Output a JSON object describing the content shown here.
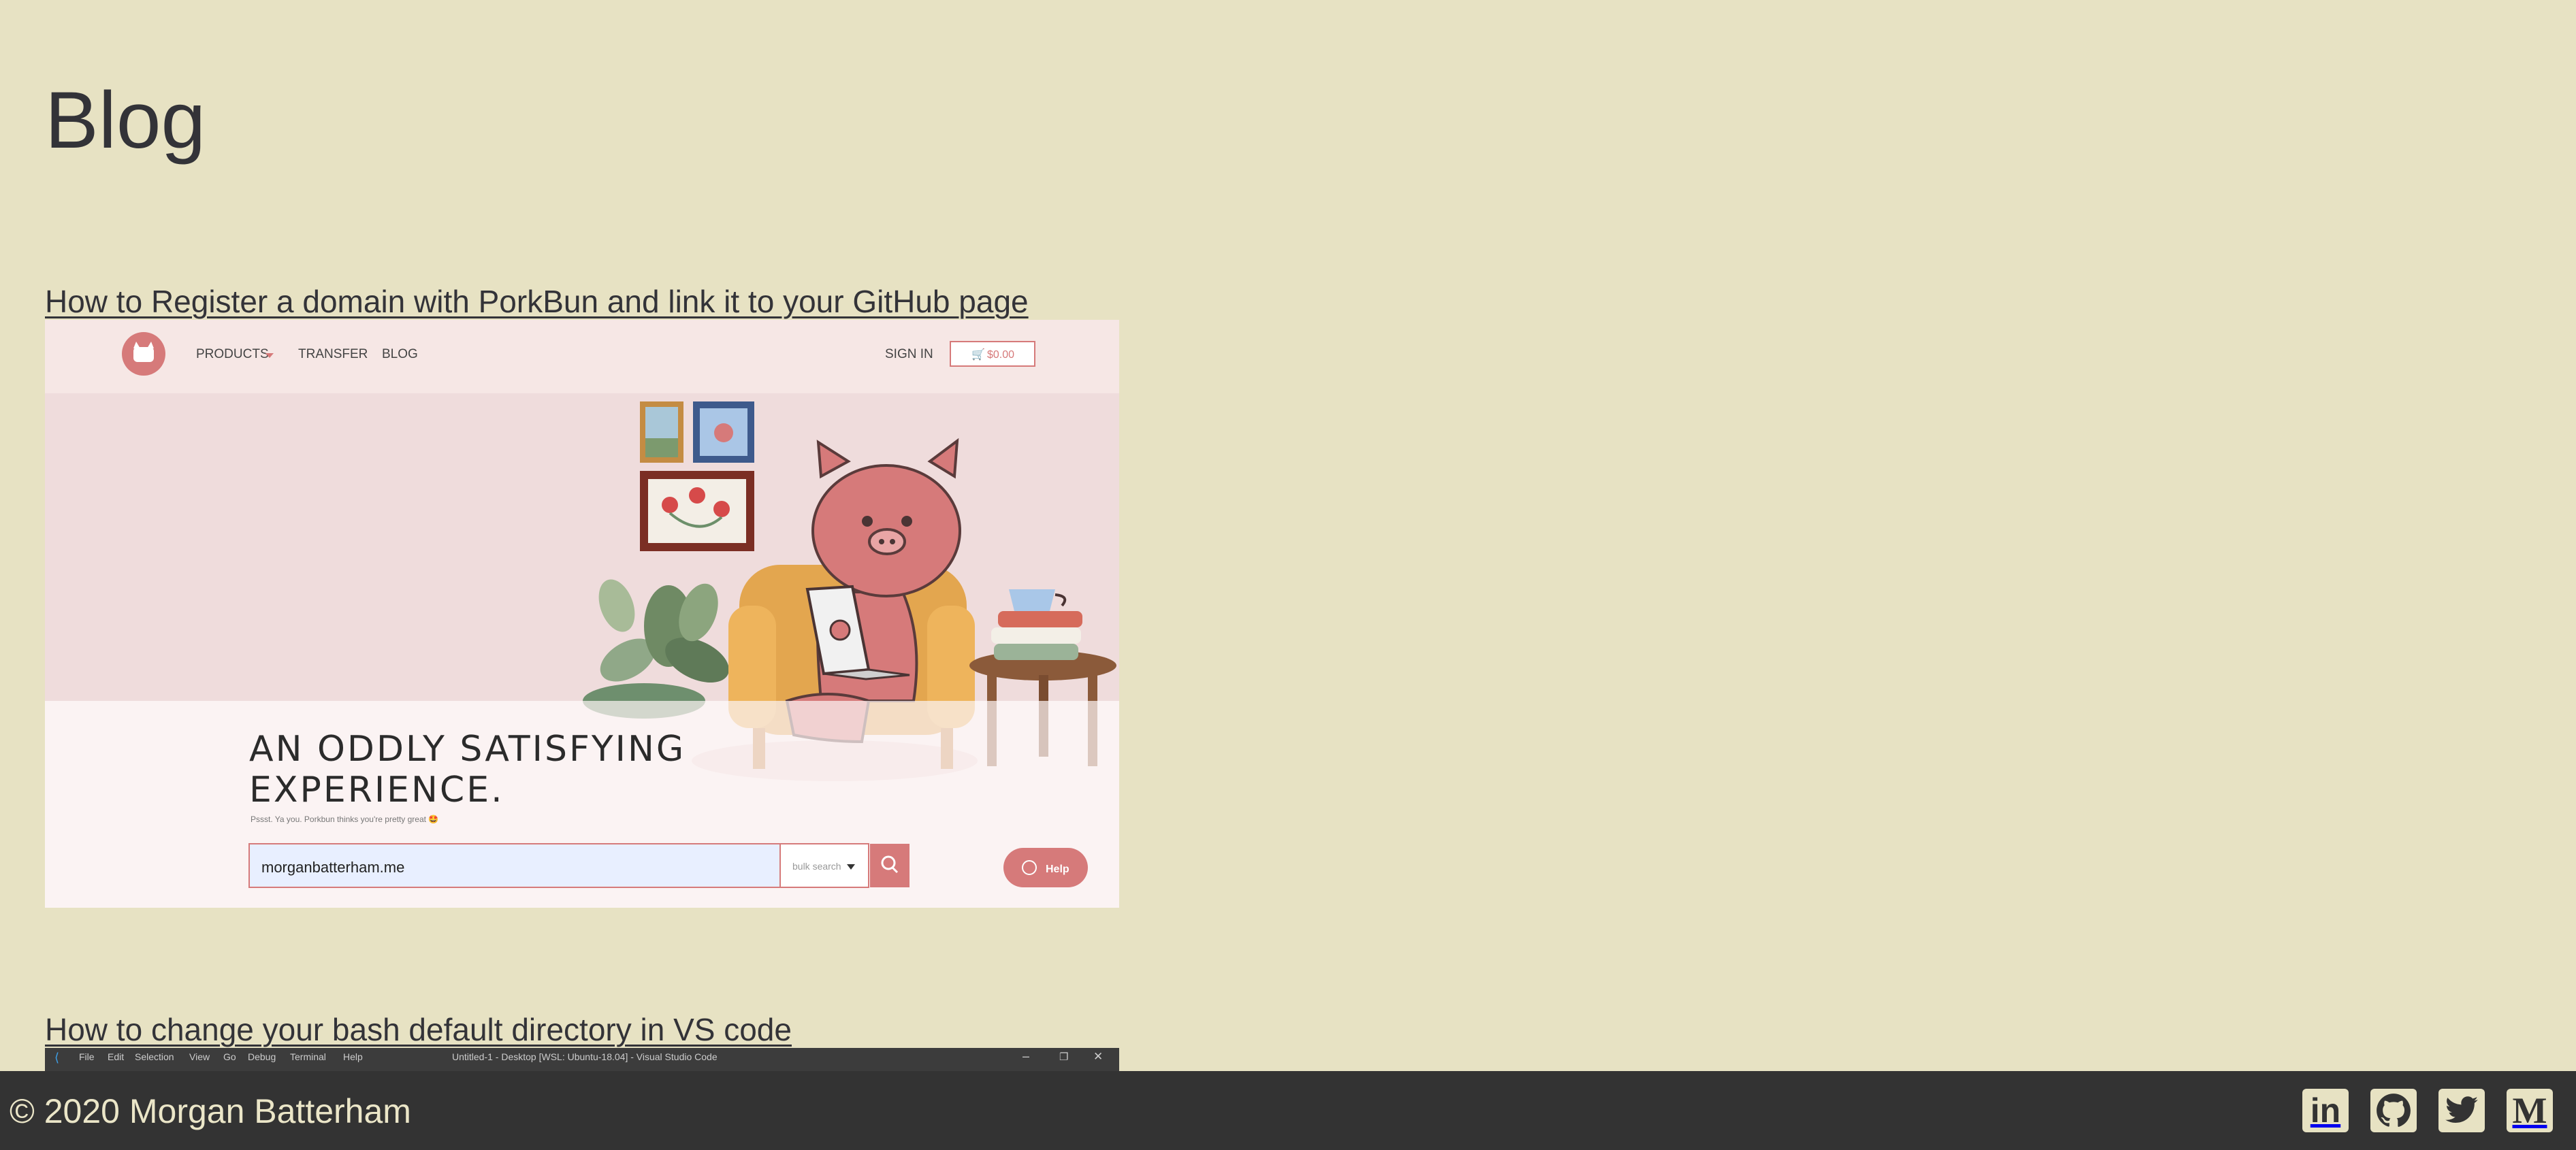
{
  "page": {
    "title": "Blog"
  },
  "posts": [
    {
      "title": "How to Register a domain with PorkBun and link it to your GitHub page",
      "screenshot": {
        "nav": {
          "products": "PRODUCTS",
          "transfer": "TRANSFER",
          "blog": "BLOG",
          "sign_in": "SIGN IN",
          "cart": "$0.00"
        },
        "headline_line1": "AN ODDLY SATISFYING",
        "headline_line2": "EXPERIENCE.",
        "subtext": "Pssst. Ya you. Porkbun thinks you're pretty great 🤩",
        "search_value": "morganbatterham.me",
        "bulk_search": "bulk search",
        "help": "Help"
      }
    },
    {
      "title": "How to change your bash default directory in VS code",
      "screenshot": {
        "menu": [
          "File",
          "Edit",
          "Selection",
          "View",
          "Go",
          "Debug",
          "Terminal",
          "Help"
        ],
        "window_title": "Untitled-1 - Desktop [WSL: Ubuntu-18.04] - Visual Studio Code"
      }
    }
  ],
  "footer": {
    "copyright": "© 2020 Morgan Batterham"
  },
  "social": [
    {
      "name": "linkedin",
      "glyph": "in"
    },
    {
      "name": "github",
      "glyph": ""
    },
    {
      "name": "twitter",
      "glyph": ""
    },
    {
      "name": "medium",
      "glyph": "M"
    }
  ],
  "colors": {
    "background": "#e7e2c3",
    "text": "#333338",
    "footer": "#333333",
    "porkbun_pink": "#d67a7a",
    "vscode_titlebar": "#3c3c3c"
  }
}
